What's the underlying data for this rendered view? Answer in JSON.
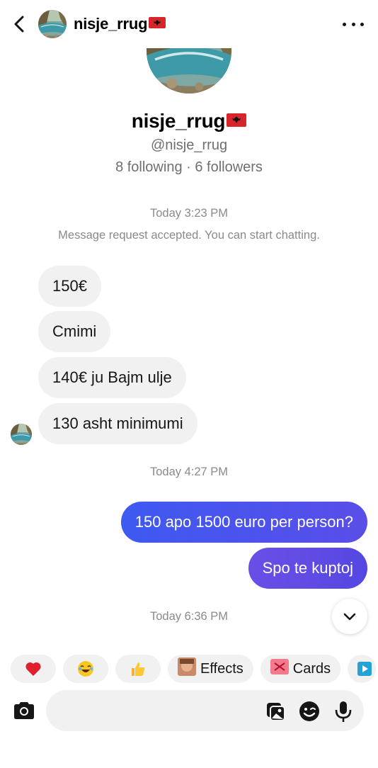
{
  "header": {
    "username": "nisje_rrug"
  },
  "profile": {
    "name": "nisje_rrug",
    "handle": "@nisje_rrug",
    "stats": "8 following · 6 followers"
  },
  "chat": {
    "time1": "Today 3:23 PM",
    "system_message": "Message request accepted. You can start chatting.",
    "incoming": [
      "150€",
      "Cmimi",
      "140€ ju Bajm ulje",
      "130 asht minimumi"
    ],
    "time2": "Today 4:27 PM",
    "outgoing": [
      "150 apo 1500 euro per person?",
      "Spo te kuptoj"
    ],
    "time3": "Today 6:36 PM"
  },
  "quick_actions": {
    "effects_label": "Effects",
    "cards_label": "Cards"
  },
  "icons": {
    "back": "chevron-left-icon",
    "more": "more-horizontal-icon",
    "scroll": "chevron-down-icon",
    "camera": "camera-icon",
    "gallery": "image-icon",
    "emoji": "smile-icon",
    "mic": "microphone-icon"
  },
  "colors": {
    "outgoing_bubble": "#3d5af1",
    "incoming_bubble": "#f1f1f2",
    "flag": "#d8242b"
  }
}
